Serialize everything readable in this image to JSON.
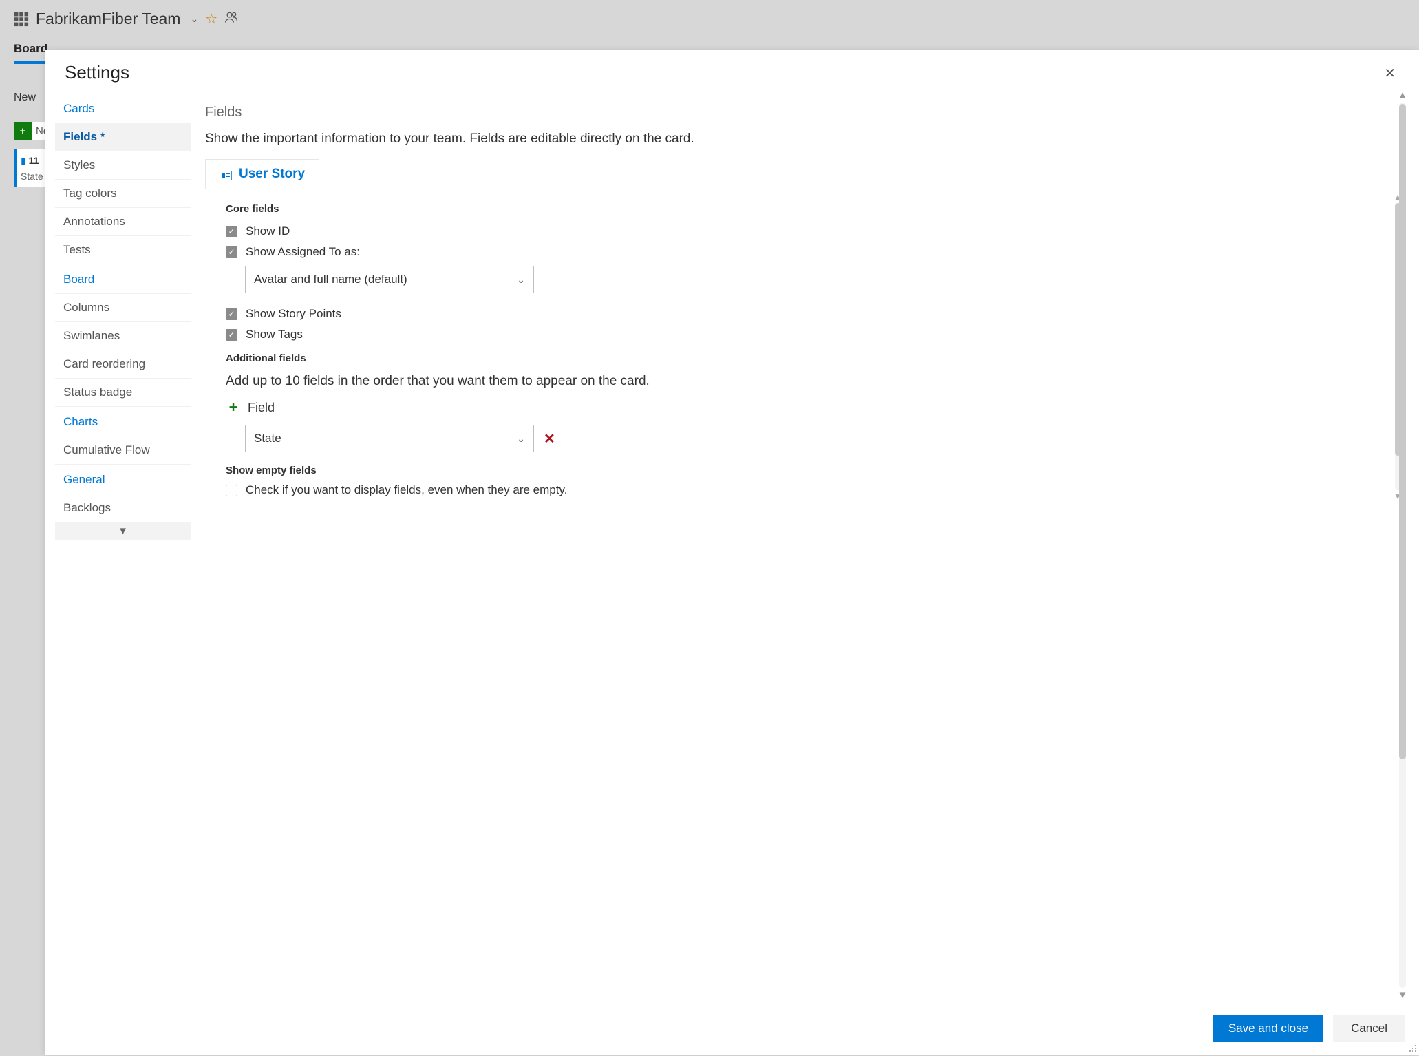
{
  "top": {
    "team_name": "FabrikamFiber Team"
  },
  "bg_tabs": {
    "active": "Board"
  },
  "bg_column": {
    "title": "New",
    "new_label": "Ne",
    "card_id": "11",
    "card_state_label": "State"
  },
  "modal": {
    "title": "Settings",
    "sidebar": {
      "groups": [
        {
          "label": "Cards",
          "items": [
            {
              "label": "Fields *",
              "active": true
            },
            {
              "label": "Styles"
            },
            {
              "label": "Tag colors"
            },
            {
              "label": "Annotations"
            },
            {
              "label": "Tests"
            }
          ]
        },
        {
          "label": "Board",
          "items": [
            {
              "label": "Columns"
            },
            {
              "label": "Swimlanes"
            },
            {
              "label": "Card reordering"
            },
            {
              "label": "Status badge"
            }
          ]
        },
        {
          "label": "Charts",
          "items": [
            {
              "label": "Cumulative Flow"
            }
          ]
        },
        {
          "label": "General",
          "items": [
            {
              "label": "Backlogs"
            }
          ]
        }
      ]
    },
    "content": {
      "heading": "Fields",
      "subheading": "Show the important information to your team. Fields are editable directly on the card.",
      "tab_label": "User Story",
      "core_fields_label": "Core fields",
      "show_id_label": "Show ID",
      "show_assigned_label": "Show Assigned To as:",
      "assigned_select_value": "Avatar and full name (default)",
      "show_story_points_label": "Show Story Points",
      "show_tags_label": "Show Tags",
      "additional_fields_label": "Additional fields",
      "additional_fields_desc": "Add up to 10 fields in the order that you want them to appear on the card.",
      "add_field_label": "Field",
      "added_field_value": "State",
      "show_empty_label": "Show empty fields",
      "show_empty_desc": "Check if you want to display fields, even when they are empty."
    },
    "footer": {
      "save_label": "Save and close",
      "cancel_label": "Cancel"
    }
  }
}
